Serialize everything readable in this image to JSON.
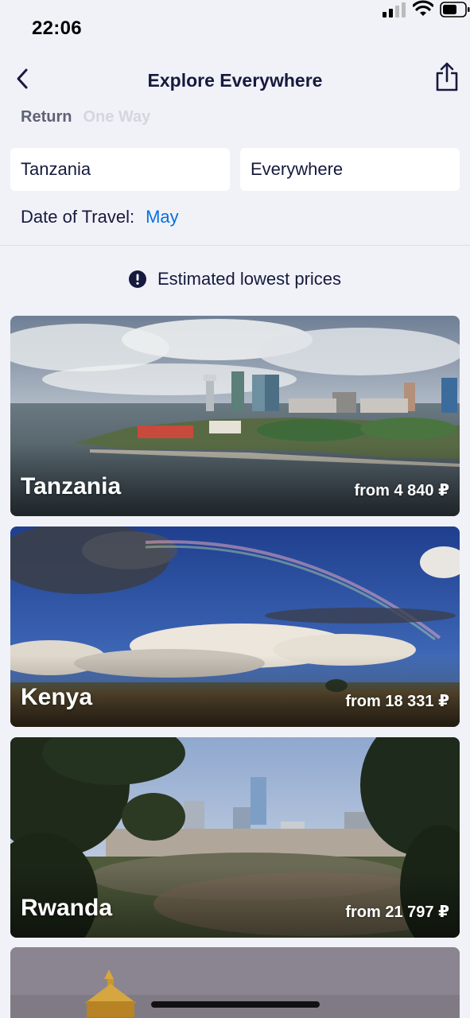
{
  "status_bar": {
    "time": "22:06"
  },
  "header": {
    "title": "Explore Everywhere"
  },
  "trip_type": {
    "return_label": "Return",
    "one_way_label": "One Way",
    "selected": "Return"
  },
  "search": {
    "origin": "Tanzania",
    "destination": "Everywhere"
  },
  "travel_date": {
    "label": "Date of Travel:",
    "value": "May"
  },
  "notice": {
    "text": "Estimated lowest prices"
  },
  "destinations": [
    {
      "name": "Tanzania",
      "price": "from 4 840 ₽"
    },
    {
      "name": "Kenya",
      "price": "from 18 331 ₽"
    },
    {
      "name": "Rwanda",
      "price": "from 21 797 ₽"
    },
    {
      "name": "",
      "price": ""
    }
  ],
  "colors": {
    "accent": "#0770e3",
    "text": "#161a3d",
    "background": "#f1f2f8",
    "muted": "#d4d6e0"
  },
  "icons": [
    "back-icon",
    "share-icon",
    "info-icon",
    "signal-icon",
    "wifi-icon",
    "battery-icon"
  ]
}
